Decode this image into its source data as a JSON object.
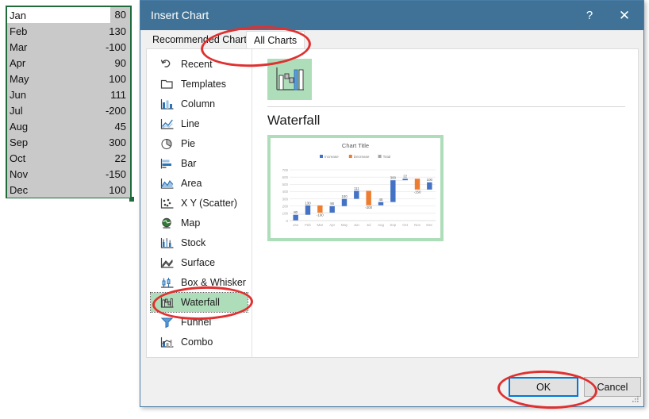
{
  "spreadsheet": {
    "rows": [
      {
        "label": "Jan",
        "value": "80"
      },
      {
        "label": "Feb",
        "value": "130"
      },
      {
        "label": "Mar",
        "value": "-100"
      },
      {
        "label": "Apr",
        "value": "90"
      },
      {
        "label": "May",
        "value": "100"
      },
      {
        "label": "Jun",
        "value": "111"
      },
      {
        "label": "Jul",
        "value": "-200"
      },
      {
        "label": "Aug",
        "value": "45"
      },
      {
        "label": "Sep",
        "value": "300"
      },
      {
        "label": "Oct",
        "value": "22"
      },
      {
        "label": "Nov",
        "value": "-150"
      },
      {
        "label": "Dec",
        "value": "100"
      }
    ],
    "selection_color": "#1f6b3b"
  },
  "dialog": {
    "title": "Insert Chart",
    "help_label": "?",
    "close_label": "✕",
    "titlebar_color": "#3f7296",
    "tabs": [
      {
        "label": "Recommended Charts",
        "active": false
      },
      {
        "label": "All Charts",
        "active": true
      }
    ],
    "chart_types": [
      {
        "label": "Recent",
        "icon": "recent-icon",
        "selected": false
      },
      {
        "label": "Templates",
        "icon": "folder-icon",
        "selected": false
      },
      {
        "label": "Column",
        "icon": "column-chart-icon",
        "selected": false
      },
      {
        "label": "Line",
        "icon": "line-chart-icon",
        "selected": false
      },
      {
        "label": "Pie",
        "icon": "pie-chart-icon",
        "selected": false
      },
      {
        "label": "Bar",
        "icon": "bar-chart-icon",
        "selected": false
      },
      {
        "label": "Area",
        "icon": "area-chart-icon",
        "selected": false
      },
      {
        "label": "X Y (Scatter)",
        "icon": "scatter-chart-icon",
        "selected": false
      },
      {
        "label": "Map",
        "icon": "map-chart-icon",
        "selected": false
      },
      {
        "label": "Stock",
        "icon": "stock-chart-icon",
        "selected": false
      },
      {
        "label": "Surface",
        "icon": "surface-chart-icon",
        "selected": false
      },
      {
        "label": "Box & Whisker",
        "icon": "box-whisker-icon",
        "selected": false
      },
      {
        "label": "Waterfall",
        "icon": "waterfall-chart-icon",
        "selected": true
      },
      {
        "label": "Funnel",
        "icon": "funnel-chart-icon",
        "selected": false
      },
      {
        "label": "Combo",
        "icon": "combo-chart-icon",
        "selected": false
      }
    ],
    "selected_type_heading": "Waterfall",
    "thumbnail_name": "waterfall-thumbnail",
    "selection_highlight": "#aeddba",
    "ok_label": "OK",
    "cancel_label": "Cancel"
  },
  "annotations": {
    "color": "#e03030",
    "items": [
      "tabs-ellipse",
      "waterfall-ellipse",
      "ok-ellipse"
    ]
  },
  "chart_data": {
    "type": "bar",
    "title": "Chart Title",
    "xlabel": "",
    "ylabel": "",
    "ylim": [
      0,
      700
    ],
    "yticks": [
      0,
      100,
      200,
      300,
      400,
      500,
      600,
      700
    ],
    "grid": true,
    "legend_position": "top",
    "legend": [
      {
        "name": "Increase",
        "color": "#4472c4"
      },
      {
        "name": "Decrease",
        "color": "#ed7d31"
      },
      {
        "name": "Total",
        "color": "#a5a5a5"
      }
    ],
    "categories": [
      "Jan",
      "Feb",
      "Mar",
      "Apr",
      "May",
      "Jun",
      "Jul",
      "Aug",
      "Sep",
      "Oct",
      "Nov",
      "Dec"
    ],
    "values": [
      80,
      130,
      -100,
      90,
      100,
      111,
      -200,
      45,
      300,
      22,
      -150,
      100
    ],
    "cumulative": [
      80,
      210,
      110,
      200,
      300,
      411,
      211,
      256,
      556,
      578,
      428,
      528
    ],
    "data_labels": [
      "80",
      "130",
      "-100",
      "90",
      "100",
      "111",
      "-200",
      "45",
      "300",
      "22",
      "-150",
      "100"
    ]
  }
}
